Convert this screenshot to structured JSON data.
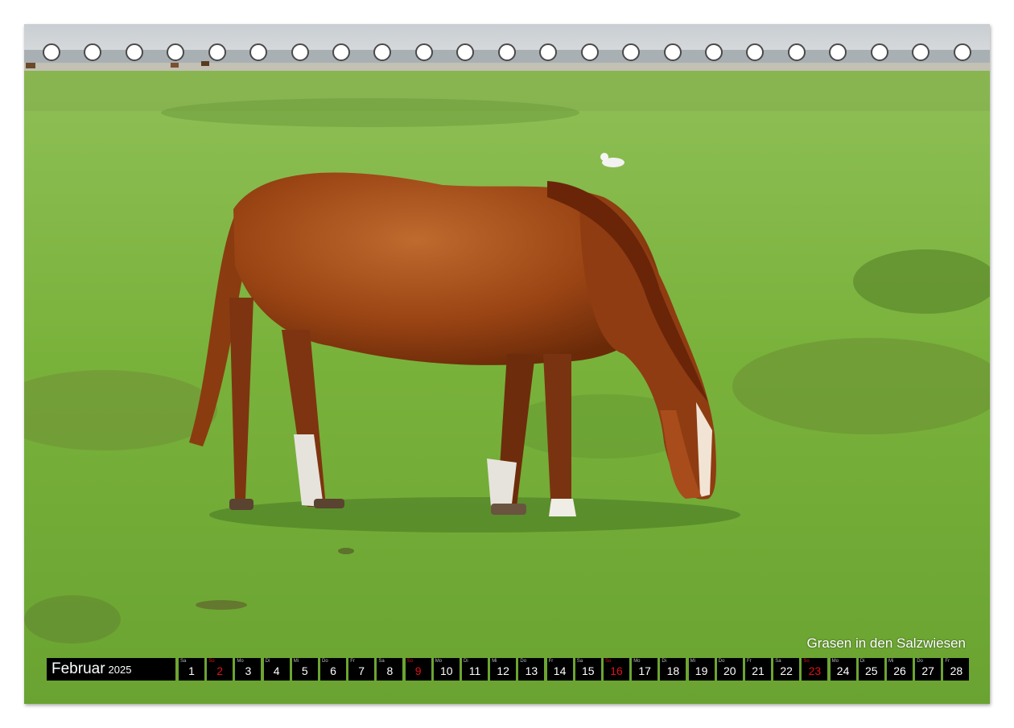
{
  "colors": {
    "background": "#ffffff",
    "calendar_cell": "#000000",
    "calendar_text": "#ffffff",
    "highlight_red": "#e0101a",
    "grass": "#7fb13f",
    "horse": "#9a4414"
  },
  "photo": {
    "subject": "grazing-chestnut-horse-in-salt-marsh"
  },
  "binding_holes_count": 23,
  "caption": "Grasen in den Salzwiesen",
  "calendar": {
    "month": "Februar",
    "year": "2025",
    "days": [
      {
        "dn": "Sa",
        "d": "1",
        "red": false
      },
      {
        "dn": "So",
        "d": "2",
        "red": true
      },
      {
        "dn": "Mo",
        "d": "3",
        "red": false
      },
      {
        "dn": "Di",
        "d": "4",
        "red": false
      },
      {
        "dn": "Mi",
        "d": "5",
        "red": false
      },
      {
        "dn": "Do",
        "d": "6",
        "red": false
      },
      {
        "dn": "Fr",
        "d": "7",
        "red": false
      },
      {
        "dn": "Sa",
        "d": "8",
        "red": false
      },
      {
        "dn": "So",
        "d": "9",
        "red": true
      },
      {
        "dn": "Mo",
        "d": "10",
        "red": false
      },
      {
        "dn": "Di",
        "d": "11",
        "red": false
      },
      {
        "dn": "Mi",
        "d": "12",
        "red": false
      },
      {
        "dn": "Do",
        "d": "13",
        "red": false
      },
      {
        "dn": "Fr",
        "d": "14",
        "red": false
      },
      {
        "dn": "Sa",
        "d": "15",
        "red": false
      },
      {
        "dn": "So",
        "d": "16",
        "red": true
      },
      {
        "dn": "Mo",
        "d": "17",
        "red": false
      },
      {
        "dn": "Di",
        "d": "18",
        "red": false
      },
      {
        "dn": "Mi",
        "d": "19",
        "red": false
      },
      {
        "dn": "Do",
        "d": "20",
        "red": false
      },
      {
        "dn": "Fr",
        "d": "21",
        "red": false
      },
      {
        "dn": "Sa",
        "d": "22",
        "red": false
      },
      {
        "dn": "So",
        "d": "23",
        "red": true
      },
      {
        "dn": "Mo",
        "d": "24",
        "red": false
      },
      {
        "dn": "Di",
        "d": "25",
        "red": false
      },
      {
        "dn": "Mi",
        "d": "26",
        "red": false
      },
      {
        "dn": "Do",
        "d": "27",
        "red": false
      },
      {
        "dn": "Fr",
        "d": "28",
        "red": false
      }
    ]
  }
}
